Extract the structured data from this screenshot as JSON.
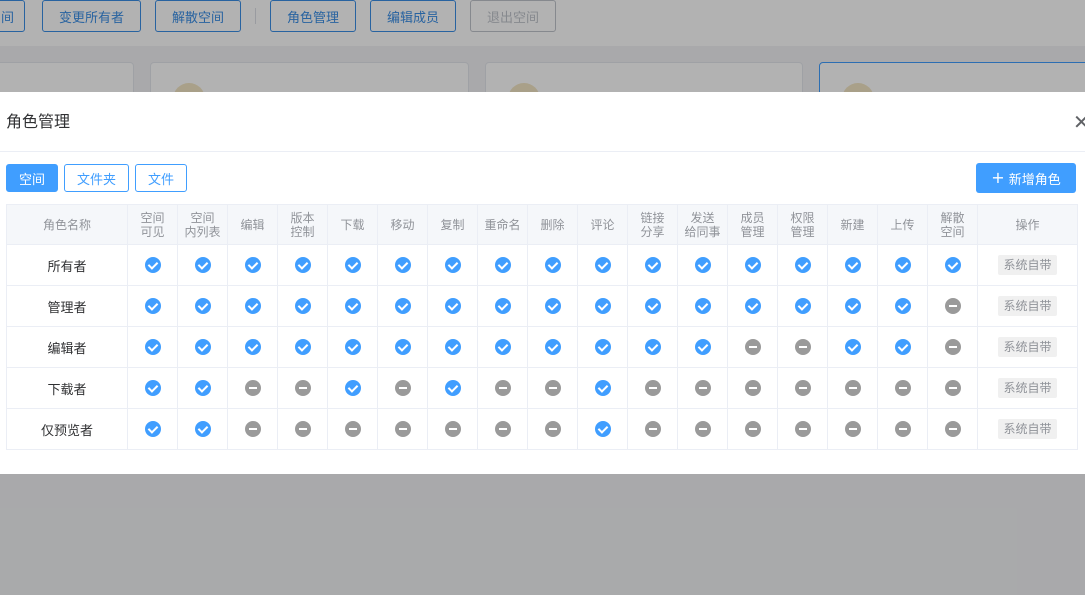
{
  "toolbar": {
    "buttons": [
      {
        "label": "间",
        "disabled": false
      },
      {
        "label": "变更所有者",
        "disabled": false
      },
      {
        "label": "解散空间",
        "disabled": false
      },
      {
        "label": "角色管理",
        "disabled": false
      },
      {
        "label": "编辑成员",
        "disabled": false
      },
      {
        "label": "退出空间",
        "disabled": true
      }
    ]
  },
  "dialog": {
    "title": "角色管理",
    "close_icon": "close-icon",
    "tabs": [
      {
        "label": "空间",
        "active": true
      },
      {
        "label": "文件夹",
        "active": false
      },
      {
        "label": "文件",
        "active": false
      }
    ],
    "add_button": {
      "label": "新增角色",
      "icon": "plus-icon"
    },
    "table": {
      "columns": [
        "角色名称",
        "空间可见",
        "空间内列表",
        "编辑",
        "版本控制",
        "下载",
        "移动",
        "复制",
        "重命名",
        "删除",
        "评论",
        "链接分享",
        "发送给同事",
        "成员管理",
        "权限管理",
        "新建",
        "上传",
        "解散空间",
        "操作"
      ],
      "column_lines": [
        [
          "角色名称"
        ],
        [
          "空间",
          "可见"
        ],
        [
          "空间",
          "内列表"
        ],
        [
          "编辑"
        ],
        [
          "版本",
          "控制"
        ],
        [
          "下载"
        ],
        [
          "移动"
        ],
        [
          "复制"
        ],
        [
          "重命名"
        ],
        [
          "删除"
        ],
        [
          "评论"
        ],
        [
          "链接",
          "分享"
        ],
        [
          "发送",
          "给同事"
        ],
        [
          "成员",
          "管理"
        ],
        [
          "权限",
          "管理"
        ],
        [
          "新建"
        ],
        [
          "上传"
        ],
        [
          "解散",
          "空间"
        ],
        [
          "操作"
        ]
      ],
      "rows": [
        {
          "name": "所有者",
          "perms": [
            1,
            1,
            1,
            1,
            1,
            1,
            1,
            1,
            1,
            1,
            1,
            1,
            1,
            1,
            1,
            1,
            1
          ],
          "action": "系统自带"
        },
        {
          "name": "管理者",
          "perms": [
            1,
            1,
            1,
            1,
            1,
            1,
            1,
            1,
            1,
            1,
            1,
            1,
            1,
            1,
            1,
            1,
            0
          ],
          "action": "系统自带"
        },
        {
          "name": "编辑者",
          "perms": [
            1,
            1,
            1,
            1,
            1,
            1,
            1,
            1,
            1,
            1,
            1,
            1,
            0,
            0,
            1,
            1,
            0
          ],
          "action": "系统自带"
        },
        {
          "name": "下载者",
          "perms": [
            1,
            1,
            0,
            0,
            1,
            0,
            1,
            0,
            0,
            1,
            0,
            0,
            0,
            0,
            0,
            0,
            0
          ],
          "action": "系统自带"
        },
        {
          "name": "仅预览者",
          "perms": [
            1,
            1,
            0,
            0,
            0,
            0,
            0,
            0,
            0,
            1,
            0,
            0,
            0,
            0,
            0,
            0,
            0
          ],
          "action": "系统自带"
        }
      ],
      "icons": {
        "granted": "check-circle-icon",
        "denied": "minus-circle-icon"
      }
    }
  },
  "colors": {
    "primary": "#409eff",
    "denied": "#9a9a9a",
    "mask": "rgba(0,0,0,0.3)"
  }
}
